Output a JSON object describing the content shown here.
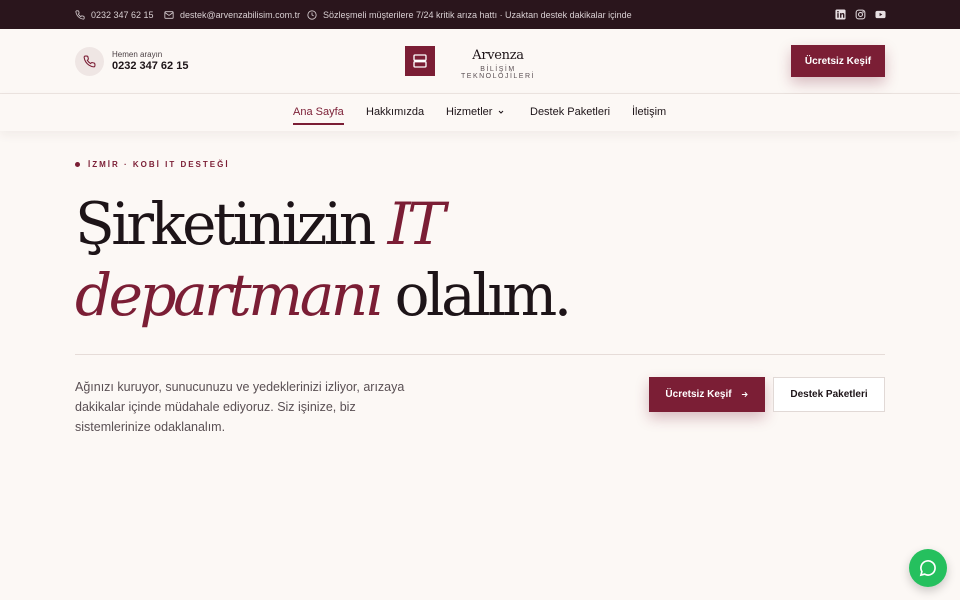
{
  "topbar": {
    "phone": "0232 347 62 15",
    "email": "destek@arvenzabilisim.com.tr",
    "notice": "Sözleşmeli müşterilere 7/24 kritik arıza hattı · Uzaktan destek dakikalar içinde",
    "social": [
      "linkedin-icon",
      "instagram-icon",
      "youtube-icon"
    ]
  },
  "header": {
    "call_label": "Hemen arayın",
    "call_number": "0232 347 62 15",
    "logo_name": "Arvenza",
    "logo_sub": "BİLİŞİM TEKNOLOJİLERİ",
    "cta_label": "Ücretsiz Keşif"
  },
  "nav": {
    "items": [
      {
        "label": "Ana Sayfa",
        "active": true
      },
      {
        "label": "Hakkımızda"
      },
      {
        "label": "Hizmetler",
        "dropdown": true
      },
      {
        "label": "Destek Paketleri"
      },
      {
        "label": "İletişim"
      }
    ]
  },
  "hero": {
    "eyebrow": "İZMİR · KOBİ IT DESTEĞİ",
    "title_line1_a": "Şirketinizin ",
    "title_line1_b": "IT",
    "title_line2_a": "departmanı",
    "title_line2_b": " olalım.",
    "description": "Ağınızı kuruyor, sunucunuzu ve yedeklerinizi izliyor, arızaya dakikalar içinde müdahale ediyoruz. Siz işinize, biz sistemlerinize odaklanalım.",
    "primary_cta": "Ücretsiz Keşif",
    "secondary_cta": "Destek Paketleri"
  },
  "colors": {
    "brand": "#7b1e35",
    "topbar_bg": "#2a151c",
    "page_bg": "#fcf8f5",
    "whatsapp": "#25c05e"
  }
}
